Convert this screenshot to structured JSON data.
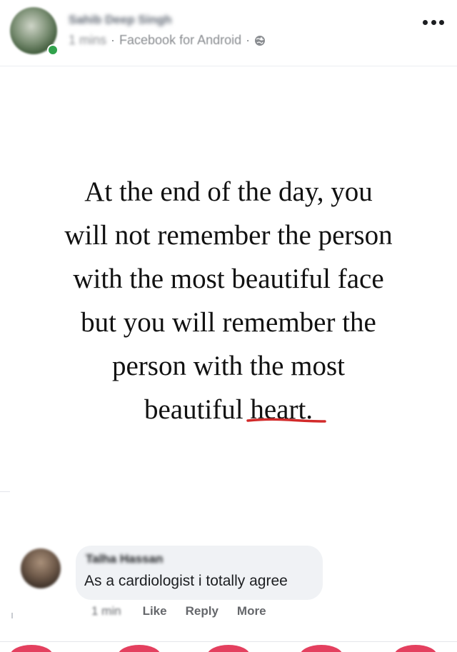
{
  "header": {
    "author_name": "Sahib Deep Singh",
    "time": "1 mins",
    "source": "Facebook for Android",
    "separator": "·",
    "privacy_icon": "globe-icon",
    "menu_icon": "more-horizontal-icon"
  },
  "post": {
    "quote_lines": [
      "At the end of the day, you",
      "will not remember the person",
      "with the most beautiful face",
      "but you will remember the",
      "person with the most",
      "beautiful heart."
    ],
    "underline_color": "#d22a2a"
  },
  "comment": {
    "name": "Talha Hassan",
    "text": "As a cardiologist i totally agree",
    "time": "1 min",
    "actions": {
      "like": "Like",
      "reply": "Reply",
      "more": "More"
    }
  },
  "colors": {
    "accent_online": "#31a24c",
    "bubble_bg": "#f0f2f5",
    "action_text": "#65676b",
    "reaction_accent": "#e4405f"
  }
}
